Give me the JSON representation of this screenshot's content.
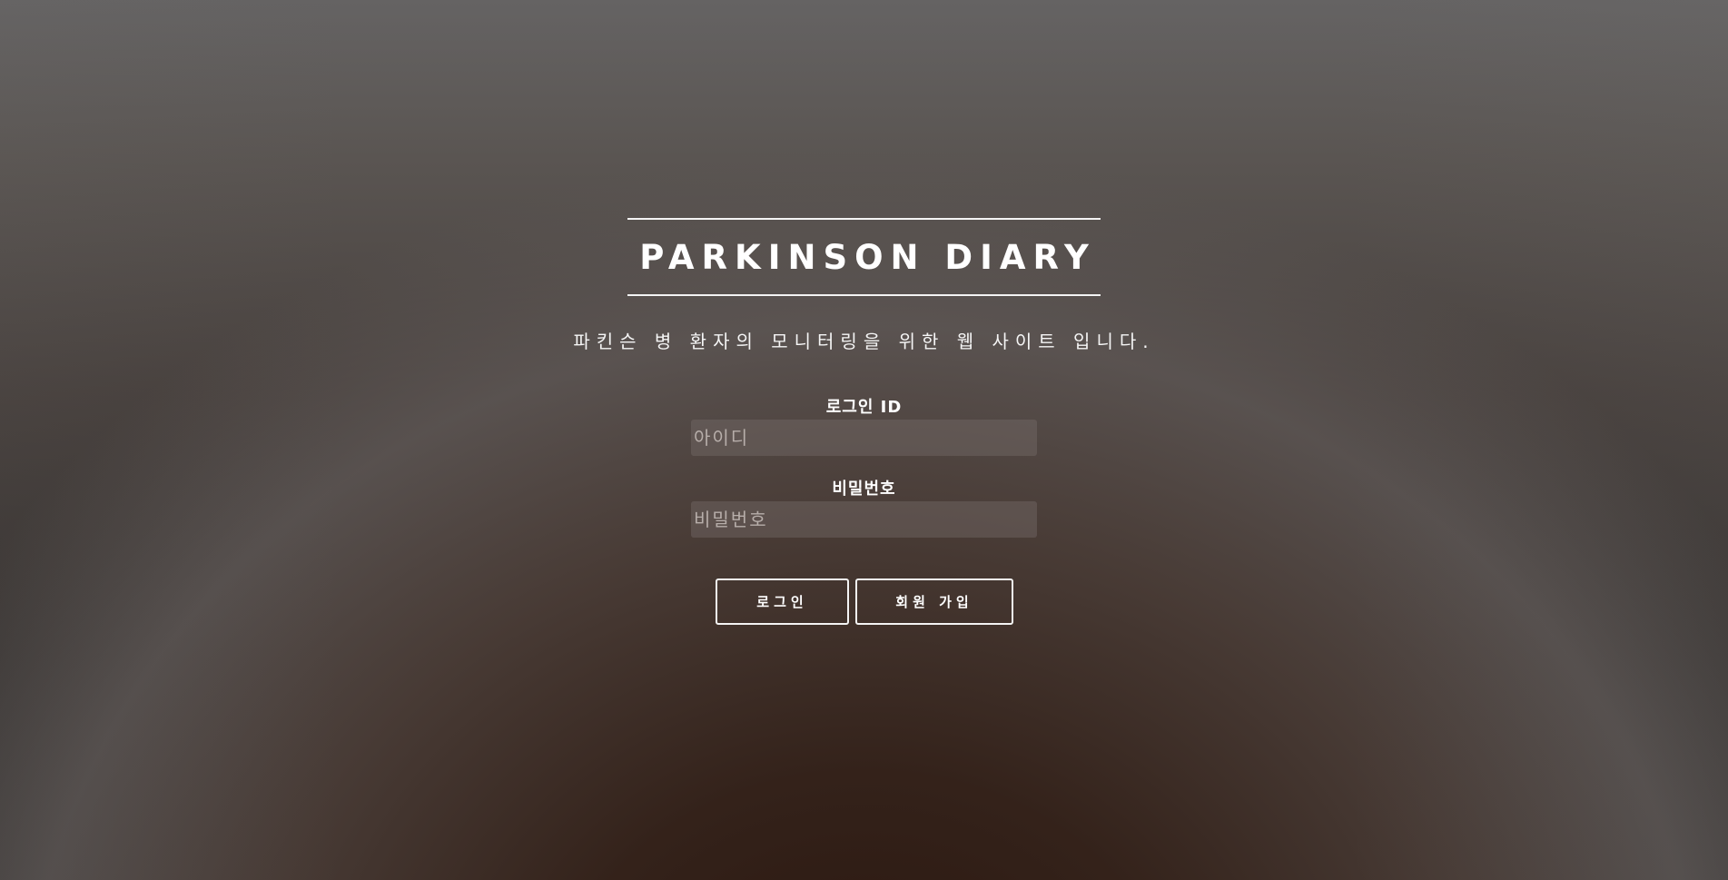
{
  "site": {
    "title": "PARKINSON DIARY",
    "subtitle": "파킨슨 병 환자의 모니터링을 위한 웹 사이트 입니다."
  },
  "login_form": {
    "id_label": "로그인 ID",
    "id_placeholder": "아이디",
    "id_value": "",
    "password_label": "비밀번호",
    "password_placeholder": "비밀번호",
    "password_value": "",
    "login_button": "로그인",
    "signup_button": "회원 가입"
  },
  "colors": {
    "text": "#ffffff",
    "border": "#f4f4f4",
    "input_bg": "rgba(120,110,108,0.42)"
  }
}
